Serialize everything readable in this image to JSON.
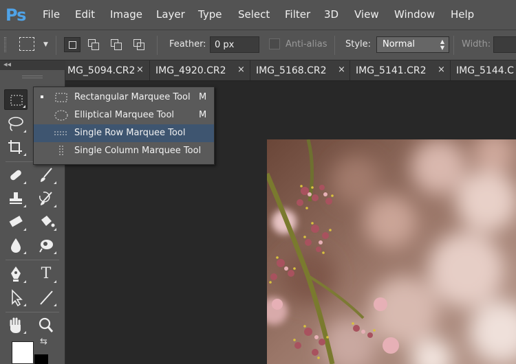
{
  "app": {
    "logo": "Ps"
  },
  "menu": [
    "File",
    "Edit",
    "Image",
    "Layer",
    "Type",
    "Select",
    "Filter",
    "3D",
    "View",
    "Window",
    "Help"
  ],
  "options": {
    "feather_label": "Feather:",
    "feather_value": "0 px",
    "antialias_label": "Anti-alias",
    "style_label": "Style:",
    "style_value": "Normal",
    "width_label": "Width:"
  },
  "panel_collapse": "◂◂",
  "tabs": [
    {
      "label": "MG_5094.CR2",
      "close": "×"
    },
    {
      "label": "IMG_4920.CR2",
      "close": "×"
    },
    {
      "label": "IMG_5168.CR2",
      "close": "×"
    },
    {
      "label": "IMG_5141.CR2",
      "close": "×"
    },
    {
      "label": "IMG_5144.C",
      "close": ""
    }
  ],
  "flyout": {
    "items": [
      {
        "label": "Rectangular Marquee Tool",
        "shortcut": "M",
        "active": true,
        "icon": "rectangular-marquee-icon"
      },
      {
        "label": "Elliptical Marquee Tool",
        "shortcut": "M",
        "active": false,
        "icon": "elliptical-marquee-icon"
      },
      {
        "label": "Single Row Marquee Tool",
        "shortcut": "",
        "active": false,
        "icon": "single-row-marquee-icon"
      },
      {
        "label": "Single Column Marquee Tool",
        "shortcut": "",
        "active": false,
        "icon": "single-column-marquee-icon"
      }
    ]
  },
  "tools": {
    "type_tool": "T"
  },
  "colors": {
    "accent_logo": "#4fa3e8",
    "highlight": "#3e5570",
    "foreground": "#ffffff",
    "background": "#000000"
  }
}
